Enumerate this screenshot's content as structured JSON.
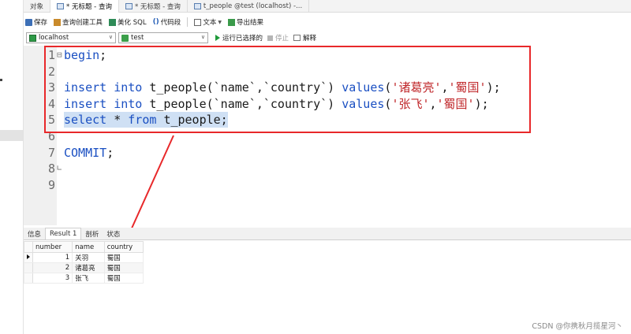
{
  "tabs": [
    {
      "label": "对象",
      "active": false,
      "icon": "none"
    },
    {
      "label": "* 无标题 - 查询",
      "active": true,
      "icon": "query-icon"
    },
    {
      "label": "* 无标题 - 查询",
      "active": false,
      "icon": "query-icon"
    },
    {
      "label": "t_people @test (localhost) -...",
      "active": false,
      "icon": "table-icon"
    }
  ],
  "toolbar": {
    "save": "保存",
    "query_builder": "查询创建工具",
    "beautify": "美化 SQL",
    "code_snippet_glyph": "()",
    "code_snippet": "代码段",
    "text": "文本",
    "export": "导出结果"
  },
  "connection": {
    "host": "localhost",
    "database": "test",
    "run_selected": "运行已选择的",
    "stop": "停止",
    "explain": "解释"
  },
  "editor": {
    "lines": [
      {
        "n": "1",
        "fold": "⊟",
        "code": [
          {
            "t": "begin",
            "c": "kw"
          },
          {
            "t": ";",
            "c": "plain"
          }
        ]
      },
      {
        "n": "2",
        "fold": "",
        "code": []
      },
      {
        "n": "3",
        "fold": "",
        "code": [
          {
            "t": "insert into ",
            "c": "kw"
          },
          {
            "t": "t_people(`name`,`country`) ",
            "c": "plain"
          },
          {
            "t": "values",
            "c": "kw"
          },
          {
            "t": "(",
            "c": "plain"
          },
          {
            "t": "'诸葛亮'",
            "c": "str"
          },
          {
            "t": ",",
            "c": "plain"
          },
          {
            "t": "'蜀国'",
            "c": "str"
          },
          {
            "t": ");",
            "c": "plain"
          }
        ]
      },
      {
        "n": "4",
        "fold": "",
        "code": [
          {
            "t": "insert into ",
            "c": "kw"
          },
          {
            "t": "t_people(`name`,`country`) ",
            "c": "plain"
          },
          {
            "t": "values",
            "c": "kw"
          },
          {
            "t": "(",
            "c": "plain"
          },
          {
            "t": "'张飞'",
            "c": "str"
          },
          {
            "t": ",",
            "c": "plain"
          },
          {
            "t": "'蜀国'",
            "c": "str"
          },
          {
            "t": ");",
            "c": "plain"
          }
        ]
      },
      {
        "n": "5",
        "fold": "",
        "highlight": true,
        "code": [
          {
            "t": "select ",
            "c": "kw"
          },
          {
            "t": "* ",
            "c": "plain"
          },
          {
            "t": "from ",
            "c": "kw"
          },
          {
            "t": "t_people;",
            "c": "plain"
          }
        ]
      },
      {
        "n": "6",
        "fold": "",
        "code": []
      },
      {
        "n": "7",
        "fold": "",
        "code": [
          {
            "t": "COMMIT",
            "c": "kw"
          },
          {
            "t": ";",
            "c": "plain"
          }
        ]
      },
      {
        "n": "8",
        "fold": "∟",
        "code": []
      },
      {
        "n": "9",
        "fold": "",
        "code": []
      }
    ]
  },
  "result": {
    "tabs": [
      {
        "label": "信息",
        "active": false
      },
      {
        "label": "Result 1",
        "active": true
      },
      {
        "label": "剖析",
        "active": false
      },
      {
        "label": "状态",
        "active": false
      }
    ],
    "columns": [
      "number",
      "name",
      "country"
    ],
    "rows": [
      [
        "1",
        "关羽",
        "蜀国"
      ],
      [
        "2",
        "诸葛亮",
        "蜀国"
      ],
      [
        "3",
        "张飞",
        "蜀国"
      ]
    ]
  },
  "annotation": {
    "box_color": "#e8282a",
    "arrow_color": "#e8282a"
  },
  "watermark": "CSDN @你携秋月揽星河丶"
}
